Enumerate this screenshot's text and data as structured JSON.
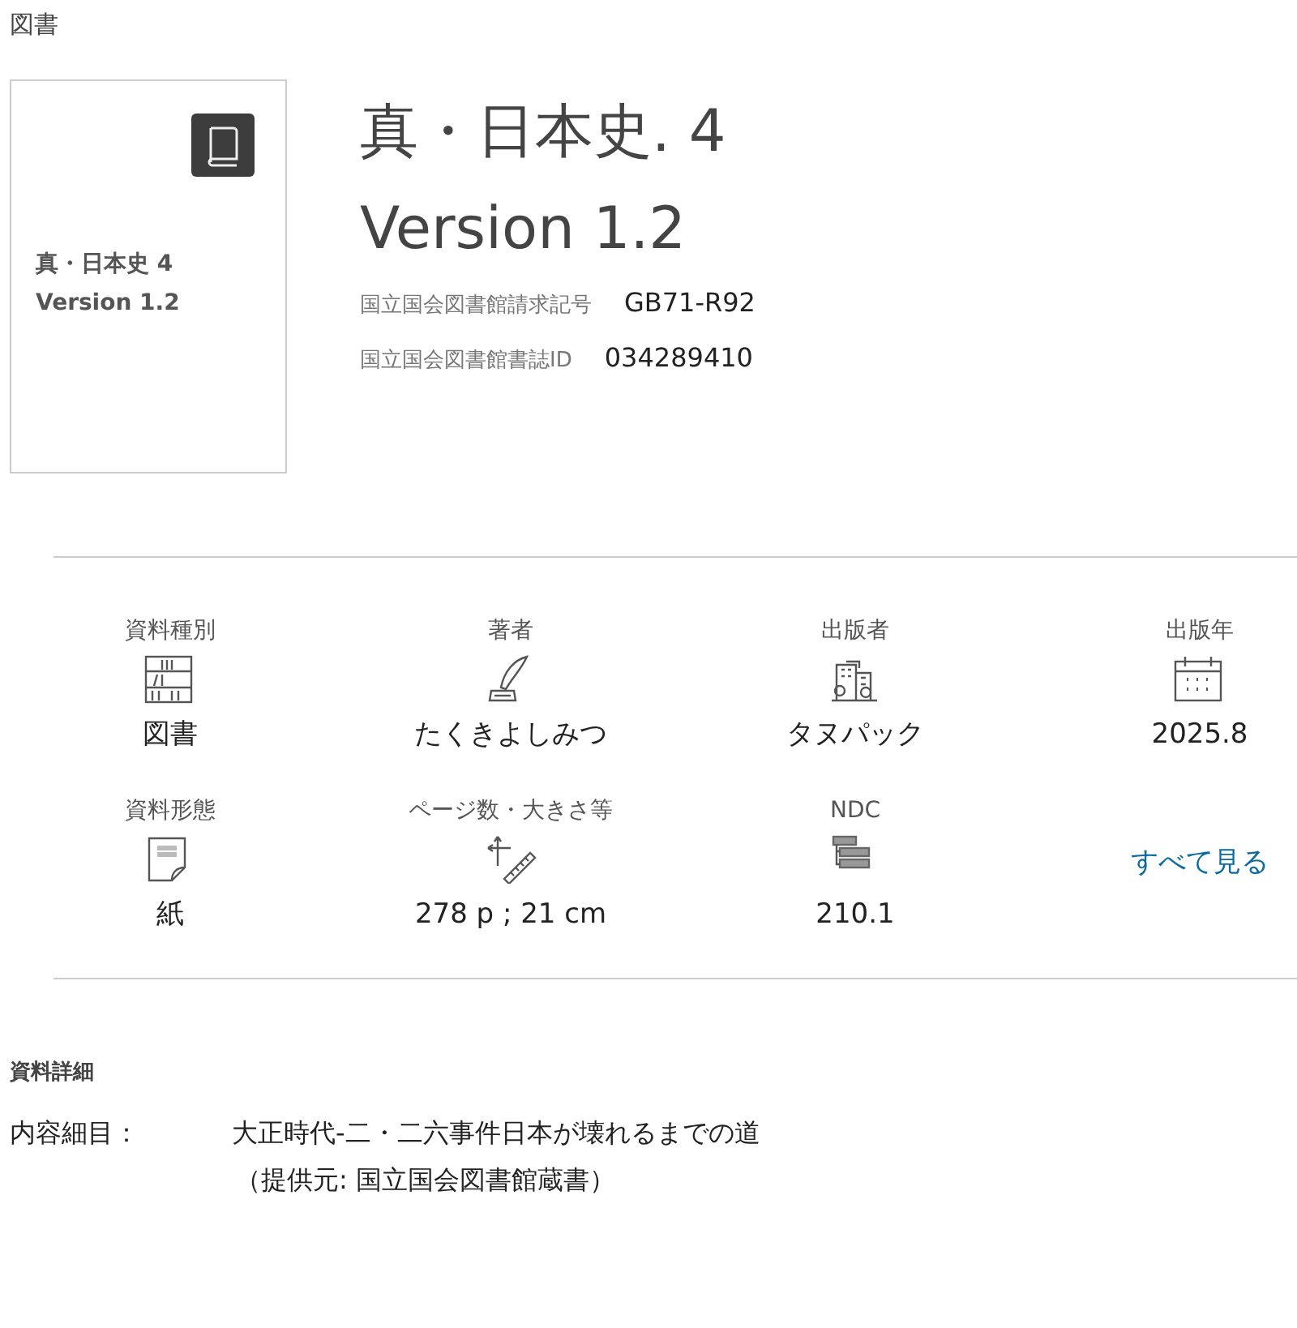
{
  "category": "図書",
  "cover": {
    "title": "真・日本史 4",
    "subtitle": "Version 1.2"
  },
  "title": "真・日本史. 4",
  "subtitle": "Version 1.2",
  "identifiers": [
    {
      "label": "国立国会図書館請求記号",
      "value": "GB71-R92"
    },
    {
      "label": "国立国会図書館書誌ID",
      "value": "034289410"
    }
  ],
  "facets": [
    {
      "kind": "facet",
      "label": "資料種別",
      "value": "図書"
    },
    {
      "kind": "facet",
      "label": "著者",
      "value": "たくきよしみつ"
    },
    {
      "kind": "facet",
      "label": "出版者",
      "value": "タヌパック"
    },
    {
      "kind": "facet",
      "label": "出版年",
      "value": "2025.8"
    },
    {
      "kind": "facet",
      "label": "資料形態",
      "value": "紙"
    },
    {
      "kind": "facet",
      "label": "ページ数・大きさ等",
      "value": "278 p ; 21 cm"
    },
    {
      "kind": "facet",
      "label": "NDC",
      "value": "210.1"
    },
    {
      "kind": "link",
      "label": "すべて見る"
    }
  ],
  "details": {
    "heading": "資料詳細",
    "rows": [
      {
        "label": "内容細目：",
        "lines": [
          "大正時代-二・二六事件日本が壊れるまでの道",
          "（提供元: 国立国会図書館蔵書）"
        ]
      }
    ]
  }
}
